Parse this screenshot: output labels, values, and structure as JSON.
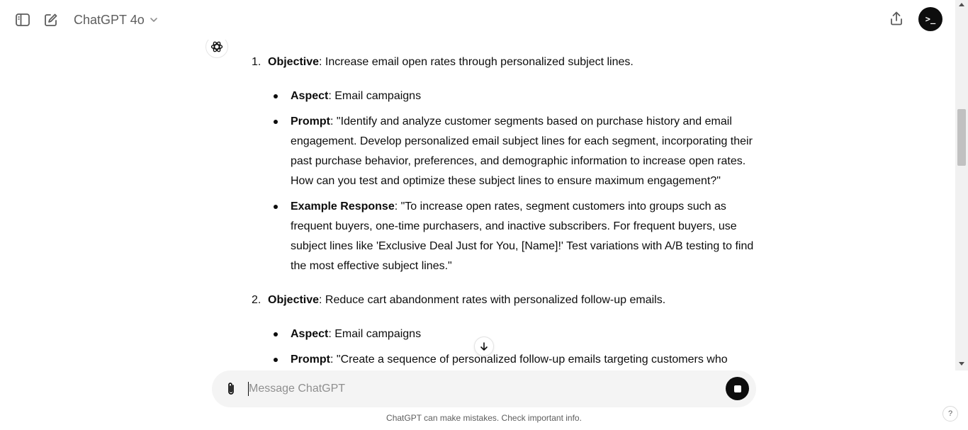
{
  "header": {
    "model_name": "ChatGPT 4o",
    "icons": {
      "sidebar_toggle": "sidebar-icon",
      "new_chat": "edit-icon",
      "model_dropdown": "chevron-down-icon",
      "share": "share-icon",
      "avatar": "terminal-icon"
    },
    "avatar_text": ">_"
  },
  "conversation": {
    "objectives": [
      {
        "number": "1.",
        "label": "Objective",
        "text": ": Increase email open rates through personalized subject lines.",
        "items": [
          {
            "label": "Aspect",
            "text": ": Email campaigns"
          },
          {
            "label": "Prompt",
            "text": ": \"Identify and analyze customer segments based on purchase history and email engagement. Develop personalized email subject lines for each segment, incorporating their past purchase behavior, preferences, and demographic information to increase open rates. How can you test and optimize these subject lines to ensure maximum engagement?\""
          },
          {
            "label": "Example Response",
            "text": ": \"To increase open rates, segment customers into groups such as frequent buyers, one-time purchasers, and inactive subscribers. For frequent buyers, use subject lines like 'Exclusive Deal Just for You, [Name]!' Test variations with A/B testing to find the most effective subject lines.\""
          }
        ]
      },
      {
        "number": "2.",
        "label": "Objective",
        "text": ": Reduce cart abandonment rates with personalized follow-up emails.",
        "items": [
          {
            "label": "Aspect",
            "text": ": Email campaigns"
          },
          {
            "label": "Prompt",
            "text": ": \"Create a sequence of personalized follow-up emails targeting customers who"
          }
        ]
      }
    ]
  },
  "composer": {
    "placeholder": "Message ChatGPT",
    "value": ""
  },
  "footer": {
    "disclaimer": "ChatGPT can make mistakes. Check important info.",
    "help_label": "?"
  },
  "colors": {
    "text": "#0d0d0d",
    "muted": "#5d5d5d",
    "composer_bg": "#f4f4f4",
    "stop_button": "#0d0d0d"
  }
}
